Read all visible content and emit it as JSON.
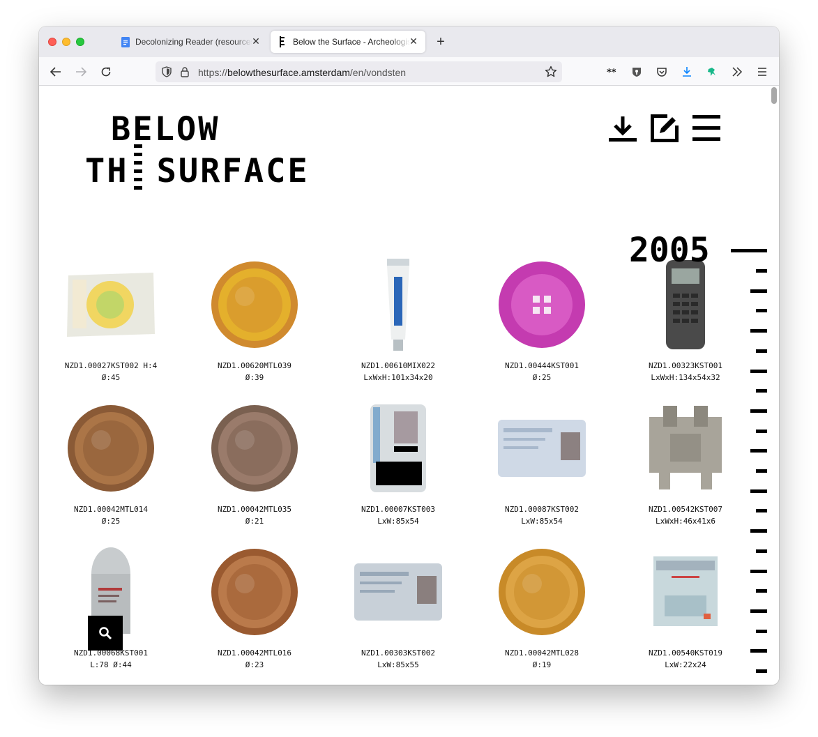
{
  "browser": {
    "tabs": [
      {
        "title": "Decolonizing Reader (resources"
      },
      {
        "title": "Below the Surface - Archeologis"
      }
    ],
    "url_prefix": "https://",
    "url_domain": "belowthesurface.amsterdam",
    "url_path": "/en/vondsten"
  },
  "site": {
    "logo_line1": "BELOW",
    "logo_line2_a": "TH",
    "logo_line2_b": "SURFACE",
    "year": "2005"
  },
  "items": [
    {
      "code": "NZD1.00027KST002 H:4",
      "dim": "Ø:45",
      "kind": "wrapper",
      "colors": [
        "#f2d24a",
        "#e9e9e0"
      ]
    },
    {
      "code": "NZD1.00620MTL039",
      "dim": "Ø:39",
      "kind": "coin",
      "colors": [
        "#d08a2e",
        "#e8b62c"
      ]
    },
    {
      "code": "NZD1.00610MIX022",
      "dim": "LxWxH:101x34x20",
      "kind": "tube",
      "colors": [
        "#eef0f0",
        "#2a66b8"
      ]
    },
    {
      "code": "NZD1.00444KST001",
      "dim": "Ø:25",
      "kind": "button",
      "colors": [
        "#c43bb0",
        "#d85ac4"
      ]
    },
    {
      "code": "NZD1.00323KST001",
      "dim": "LxWxH:134x54x32",
      "kind": "phone",
      "colors": [
        "#4a4a4a",
        "#2a2a2a"
      ]
    },
    {
      "code": "NZD1.00042MTL014",
      "dim": "Ø:25",
      "kind": "coin",
      "colors": [
        "#8a5a36",
        "#b07a4a"
      ]
    },
    {
      "code": "NZD1.00042MTL035",
      "dim": "Ø:21",
      "kind": "coin",
      "colors": [
        "#7a6050",
        "#a08070"
      ]
    },
    {
      "code": "NZD1.00007KST003",
      "dim": "LxW:85x54",
      "kind": "card-v",
      "colors": [
        "#d8dde0",
        "#000000"
      ]
    },
    {
      "code": "NZD1.00087KST002",
      "dim": "LxW:85x54",
      "kind": "card-h",
      "colors": [
        "#cfd9e6",
        "#a8b8cc"
      ]
    },
    {
      "code": "NZD1.00542KST007",
      "dim": "LxWxH:46x41x6",
      "kind": "block",
      "colors": [
        "#a8a49a",
        "#8c887e"
      ]
    },
    {
      "code": "NZD1.00068KST001",
      "dim": "L:78 Ø:44",
      "kind": "bullet",
      "colors": [
        "#c8ccce",
        "#a0a4a8"
      ]
    },
    {
      "code": "NZD1.00042MTL016",
      "dim": "Ø:23",
      "kind": "coin",
      "colors": [
        "#9a5a30",
        "#c08050"
      ]
    },
    {
      "code": "NZD1.00303KST002",
      "dim": "LxW:85x55",
      "kind": "card-h",
      "colors": [
        "#c8d0d8",
        "#98a8b8"
      ]
    },
    {
      "code": "NZD1.00042MTL028",
      "dim": "Ø:19",
      "kind": "coin",
      "colors": [
        "#c88a28",
        "#e0a84a"
      ]
    },
    {
      "code": "NZD1.00540KST019",
      "dim": "LxW:22x24",
      "kind": "ticket",
      "colors": [
        "#c8d8dc",
        "#a8c0c8"
      ]
    }
  ]
}
